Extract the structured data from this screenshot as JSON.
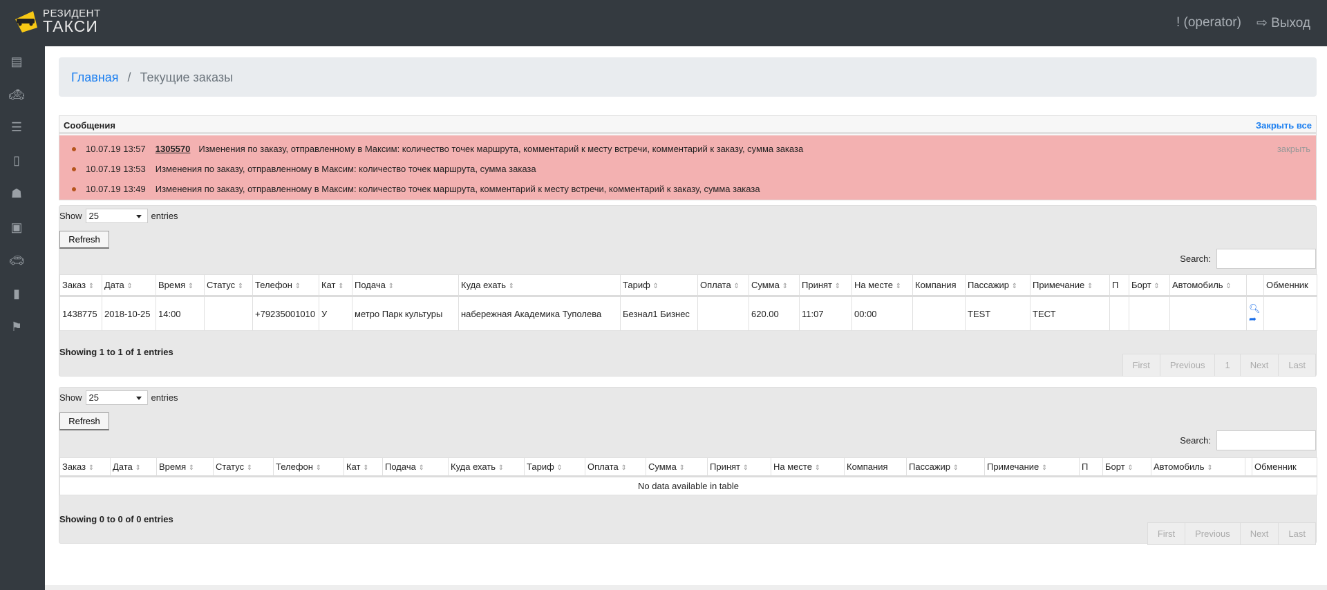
{
  "header": {
    "logo_line1": "РЕЗИДЕНТ",
    "logo_line2": "ТАКСИ",
    "user": "! (operator)",
    "logout": "Выход"
  },
  "sidebar": {
    "items": [
      {
        "icon": "list-icon"
      },
      {
        "icon": "taxi-icon"
      },
      {
        "icon": "server-icon"
      },
      {
        "icon": "excel-icon"
      },
      {
        "icon": "spy-icon"
      },
      {
        "icon": "money-icon"
      },
      {
        "icon": "car-icon"
      },
      {
        "icon": "file-icon"
      },
      {
        "icon": "chart-icon"
      }
    ]
  },
  "breadcrumb": {
    "home": "Главная",
    "separator": "/",
    "current": "Текущие заказы"
  },
  "messages": {
    "title": "Сообщения",
    "close_all": "Закрыть все",
    "close": "закрыть",
    "items": [
      {
        "time": "10.07.19 13:57",
        "order": "1305570",
        "text": "Изменения по заказу, отправленному в Максим: количество точек маршрута, комментарий к месту встречи, комментарий к заказу, сумма заказа"
      },
      {
        "time": "10.07.19 13:53",
        "order": "",
        "text": "Изменения по заказу, отправленному в Максим: количество точек маршрута, сумма заказа"
      },
      {
        "time": "10.07.19 13:49",
        "order": "",
        "text": "Изменения по заказу, отправленному в Максим: количество точек маршрута, комментарий к месту встречи, комментарий к заказу, сумма заказа"
      }
    ]
  },
  "tables": [
    {
      "show_label": "Show",
      "entries_value": "25",
      "entries_label": "entries",
      "refresh": "Refresh",
      "search_label": "Search:",
      "search_value": "",
      "columns": [
        "Заказ",
        "Дата",
        "Время",
        "Статус",
        "Телефон",
        "Кат",
        "Подача",
        "Куда ехать",
        "Тариф",
        "Оплата",
        "Сумма",
        "Принят",
        "На месте",
        "Компания",
        "Пассажир",
        "Примечание",
        "П",
        "Борт",
        "Автомобиль",
        "",
        "Обменник"
      ],
      "rows": [
        [
          "1438775",
          "2018-10-25",
          "14:00",
          "",
          "+79235001010",
          "У",
          "метро Парк культуры",
          "набережная Академика Туполева",
          "Безнал1 Бизнес",
          "",
          "620.00",
          "11:07",
          "00:00",
          "",
          "TEST",
          "ТЕСТ",
          "",
          "",
          "",
          "",
          ""
        ]
      ],
      "empty": "",
      "info": "Showing 1 to 1 of 1 entries",
      "pager": [
        "First",
        "Previous",
        "1",
        "Next",
        "Last"
      ]
    },
    {
      "show_label": "Show",
      "entries_value": "25",
      "entries_label": "entries",
      "refresh": "Refresh",
      "search_label": "Search:",
      "search_value": "",
      "columns": [
        "Заказ",
        "Дата",
        "Время",
        "Статус",
        "Телефон",
        "Кат",
        "Подача",
        "Куда ехать",
        "Тариф",
        "Оплата",
        "Сумма",
        "Принят",
        "На месте",
        "Компания",
        "Пассажир",
        "Примечание",
        "П",
        "Борт",
        "Автомобиль",
        "",
        "Обменник"
      ],
      "rows": [],
      "empty": "No data available in table",
      "info": "Showing 0 to 0 of 0 entries",
      "pager": [
        "First",
        "Previous",
        "Next",
        "Last"
      ]
    }
  ],
  "colors": {
    "topbar": "#343a40",
    "accent": "#1a7ef0",
    "message_bg": "#f3b1b1"
  }
}
